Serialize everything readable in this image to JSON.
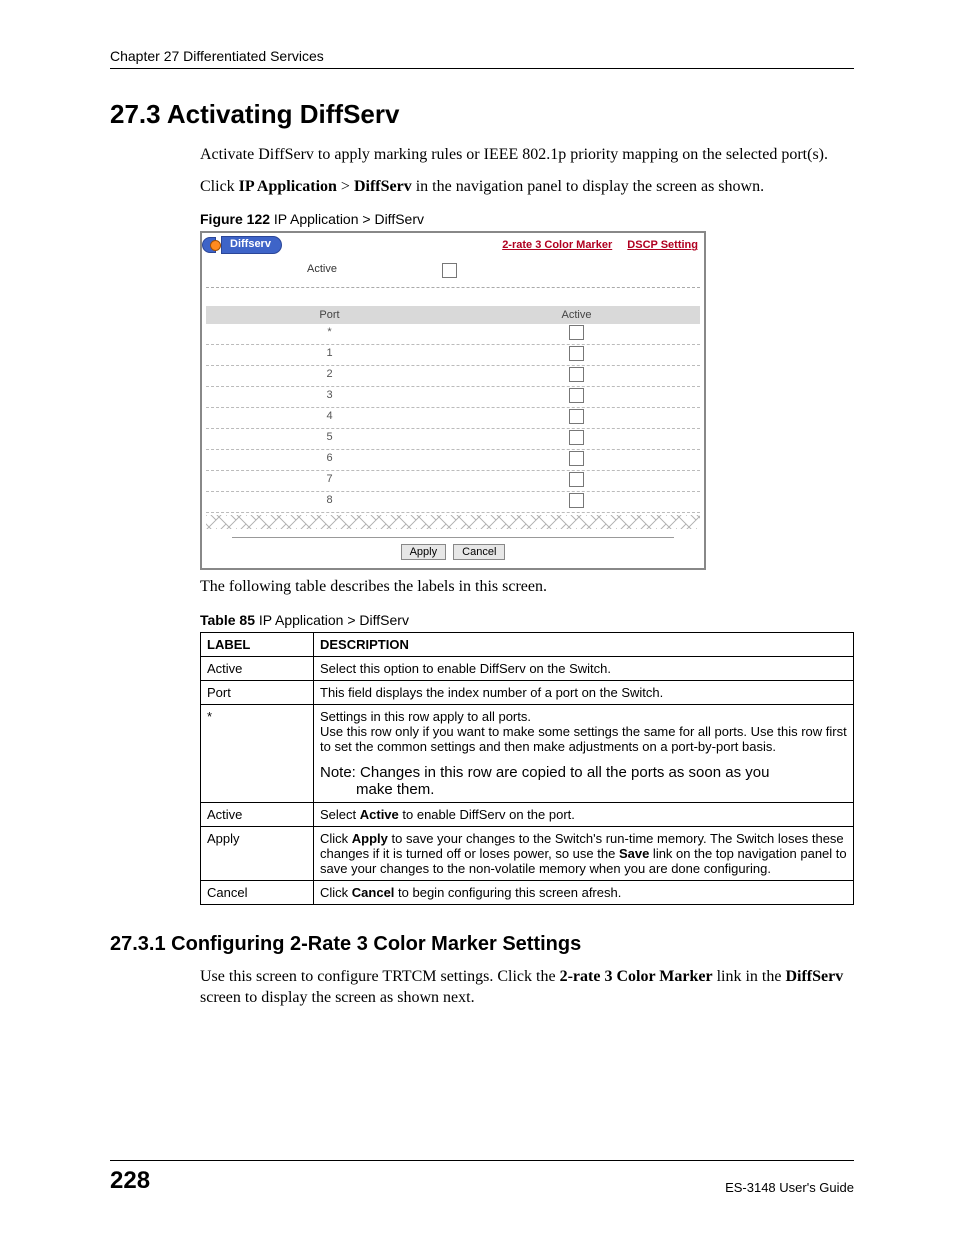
{
  "header": {
    "chapter": "Chapter 27 Differentiated Services"
  },
  "section": {
    "number_title": "27.3  Activating DiffServ",
    "para1": "Activate DiffServ to apply marking rules or IEEE 802.1p priority mapping on the selected port(s).",
    "nav_prefix": "Click ",
    "nav_path1": "IP Application",
    "nav_gt": " > ",
    "nav_path2": "DiffServ",
    "nav_suffix": " in the navigation panel to display the screen as shown."
  },
  "figure": {
    "caption_bold": "Figure 122",
    "caption_rest": "   IP Application > DiffServ",
    "panel_title": "Diffserv",
    "link1": "2-rate 3 Color Marker",
    "link2": "DSCP Setting",
    "active_label": "Active",
    "thead_port": "Port",
    "thead_active": "Active",
    "rows": [
      "*",
      "1",
      "2",
      "3",
      "4",
      "5",
      "6",
      "7",
      "8"
    ],
    "btn_apply": "Apply",
    "btn_cancel": "Cancel"
  },
  "after_figure": "The following table describes the labels in this screen.",
  "table_caption": {
    "bold": "Table 85",
    "rest": "   IP Application > DiffServ"
  },
  "table": {
    "head_label": "LABEL",
    "head_desc": "DESCRIPTION",
    "rows": [
      {
        "label": "Active",
        "desc": "Select this option to enable DiffServ on the Switch."
      },
      {
        "label": "Port",
        "desc": "This field displays the index number of a port on the Switch."
      },
      {
        "label": "*",
        "desc_line1": "Settings in this row apply to all ports.",
        "desc_line2": "Use this row only if you want to make some settings the same for all ports. Use this row first to set the common settings and then make adjustments on a port-by-port basis.",
        "note1": "Note: Changes in this row are copied to all the ports as soon as you",
        "note2": "make them."
      },
      {
        "label": "Active",
        "desc_pre": "Select ",
        "desc_bold": "Active",
        "desc_post": " to enable DiffServ on the port."
      },
      {
        "label": "Apply",
        "desc_pre": "Click ",
        "desc_bold": "Apply",
        "desc_mid": " to save your changes to the Switch's run-time memory. The Switch loses these changes if it is turned off or loses power, so use the ",
        "desc_bold2": "Save",
        "desc_post": " link on the top navigation panel to save your changes to the non-volatile memory when you are done configuring."
      },
      {
        "label": "Cancel",
        "desc_pre": "Click ",
        "desc_bold": "Cancel",
        "desc_post": " to begin configuring this screen afresh."
      }
    ]
  },
  "subsection": {
    "title": "27.3.1  Configuring 2-Rate 3 Color Marker Settings",
    "para_pre": "Use this screen to configure TRTCM settings. Click the ",
    "para_bold1": "2-rate 3 Color Marker",
    "para_mid": " link in the ",
    "para_bold2": "DiffServ",
    "para_post": " screen to display the screen as shown next."
  },
  "footer": {
    "page": "228",
    "guide": "ES-3148 User's Guide"
  }
}
